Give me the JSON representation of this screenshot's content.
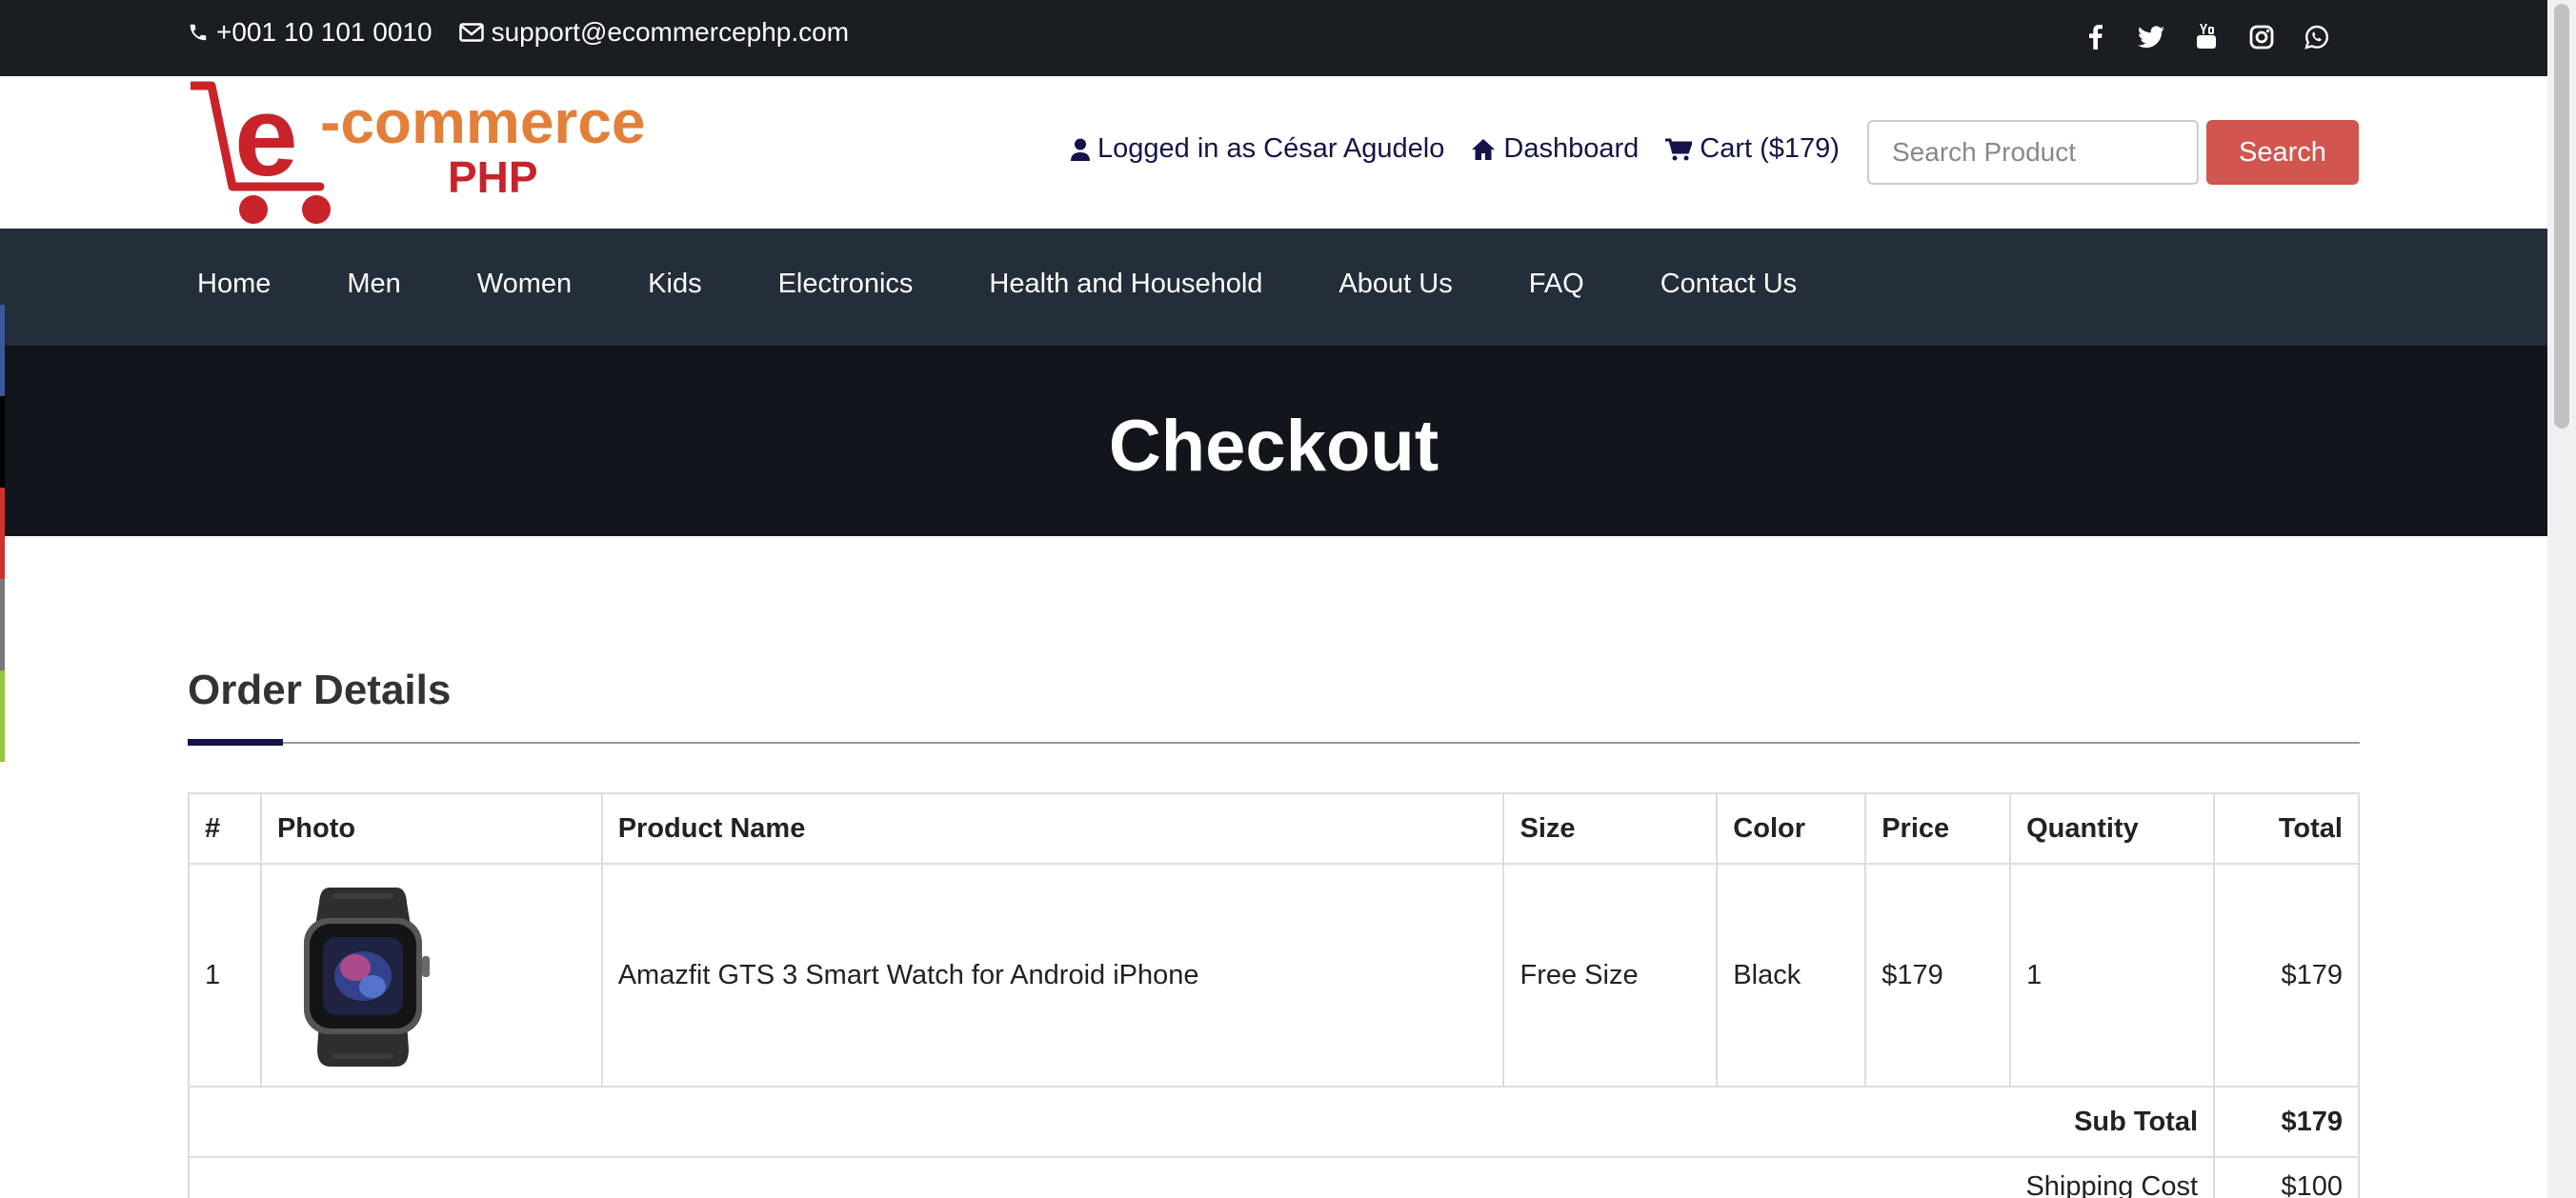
{
  "topbar": {
    "phone": "+001 10 101 0010",
    "email": "support@ecommercephp.com",
    "social": [
      "facebook-icon",
      "twitter-icon",
      "youtube-icon",
      "instagram-icon",
      "whatsapp-icon"
    ]
  },
  "logo": {
    "line1_prefix": "e",
    "line1": "-commerce",
    "line2": "PHP"
  },
  "header": {
    "logged_in": "Logged in as César Agudelo",
    "dashboard": "Dashboard",
    "cart": "Cart ($179)",
    "search_placeholder": "Search Product",
    "search_button": "Search"
  },
  "nav": [
    "Home",
    "Men",
    "Women",
    "Kids",
    "Electronics",
    "Health and Household",
    "About Us",
    "FAQ",
    "Contact Us"
  ],
  "banner": {
    "title": "Checkout"
  },
  "order": {
    "title": "Order Details",
    "columns": [
      "#",
      "Photo",
      "Product Name",
      "Size",
      "Color",
      "Price",
      "Quantity",
      "Total"
    ],
    "rows": [
      {
        "num": "1",
        "product": "Amazfit GTS 3 Smart Watch for Android iPhone",
        "size": "Free Size",
        "color": "Black",
        "price": "$179",
        "quantity": "1",
        "total": "$179"
      }
    ],
    "subtotal_label": "Sub Total",
    "subtotal": "$179",
    "shipping_label": "Shipping Cost",
    "shipping": "$100"
  },
  "colors": {
    "topbar": "#1a1d22",
    "nav": "#242d3a",
    "banner": "#12161c",
    "search_button": "#d0564f",
    "accent": "#14144a"
  }
}
